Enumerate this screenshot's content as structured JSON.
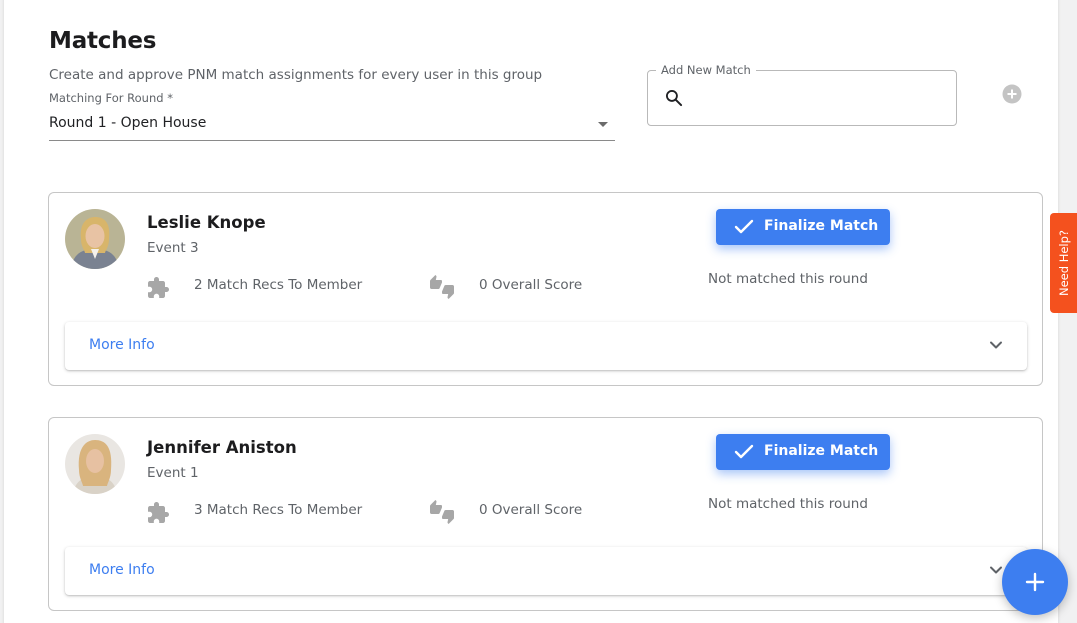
{
  "header": {
    "title": "Matches",
    "subtitle": "Create and approve PNM match assignments for every user in this group"
  },
  "round_select": {
    "label": "Matching For Round *",
    "value": "Round 1 - Open House"
  },
  "add_match": {
    "label": "Add New Match",
    "value": ""
  },
  "matches": [
    {
      "name": "Leslie Knope",
      "event": "Event 3",
      "recs": "2 Match Recs To Member",
      "score": "0 Overall Score",
      "finalize_label": "Finalize Match",
      "status": "Not matched this round",
      "more_info": "More Info",
      "avatar_colors": {
        "bg": "#b9b495",
        "hair": "#d8b56a",
        "skin": "#e8c3a4",
        "suit": "#7a8291"
      }
    },
    {
      "name": "Jennifer Aniston",
      "event": "Event 1",
      "recs": "3 Match Recs To Member",
      "score": "0 Overall Score",
      "finalize_label": "Finalize Match",
      "status": "Not matched this round",
      "more_info": "More Info",
      "avatar_colors": {
        "bg": "#e9e6e2",
        "hair": "#d9b47e",
        "skin": "#e7c1a2",
        "suit": "#d9d2c7"
      }
    }
  ],
  "help_tab": {
    "label": "Need Help?"
  },
  "colors": {
    "accent": "#3d7ef0",
    "help": "#f4511e",
    "muted_icon": "#a7a7a7"
  },
  "icons": {
    "search": "search-icon",
    "add": "add-circle-icon",
    "puzzle": "puzzle-icon",
    "thumbs": "thumbs-up-down-icon",
    "check": "check-icon",
    "chevron": "chevron-down-icon",
    "fab": "plus-icon"
  }
}
